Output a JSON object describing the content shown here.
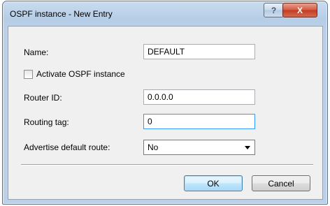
{
  "window": {
    "title": "OSPF instance - New Entry",
    "help_glyph": "?",
    "close_glyph": "X"
  },
  "form": {
    "name_label": "Name:",
    "name_value": "DEFAULT",
    "activate_label": "Activate OSPF instance",
    "activate_checked": false,
    "router_id_label": "Router ID:",
    "router_id_value": "0.0.0.0",
    "routing_tag_label": "Routing tag:",
    "routing_tag_value": "0",
    "advertise_label": "Advertise default route:",
    "advertise_value": "No"
  },
  "buttons": {
    "ok_label": "OK",
    "cancel_label": "Cancel"
  }
}
